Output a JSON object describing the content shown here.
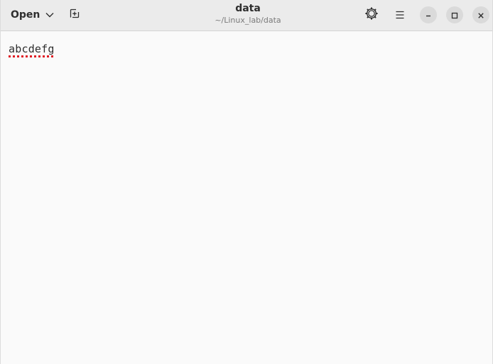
{
  "headerbar": {
    "open_label": "Open",
    "title": "data",
    "subtitle": "~/Linux_lab/data"
  },
  "icons": {
    "open_dropdown": "chevron-down-icon",
    "new_tab": "new-tab-icon",
    "settings": "gear-icon",
    "menu": "hamburger-menu-icon",
    "minimize": "minimize-icon",
    "maximize": "maximize-icon",
    "close": "close-icon"
  },
  "editor": {
    "content": "abcdefg",
    "spellcheck_color": "#e01b24"
  }
}
